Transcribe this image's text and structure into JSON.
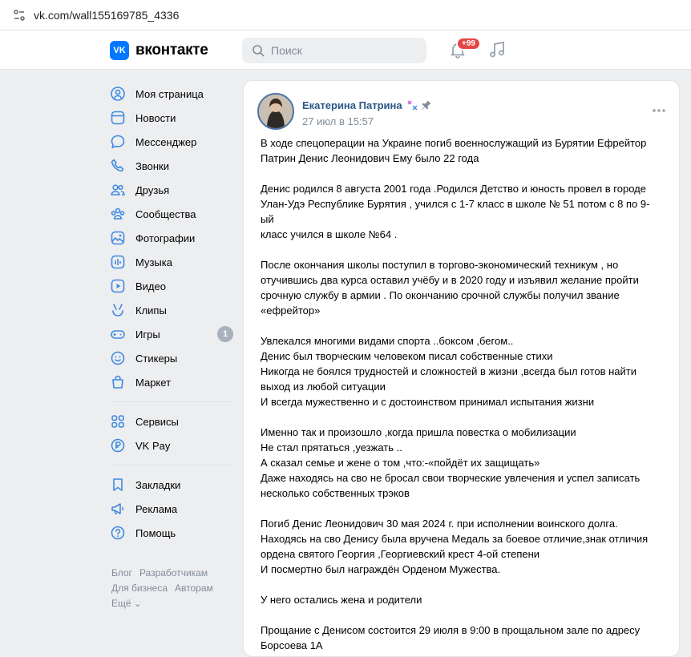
{
  "browser": {
    "url": "vk.com/wall155169785_4336"
  },
  "header": {
    "logo_text": "вконтакте",
    "logo_mark": "VK",
    "search_placeholder": "Поиск",
    "notifications_badge": "+99"
  },
  "menu": {
    "items": [
      {
        "label": "Моя страница",
        "icon": "user-circle-icon"
      },
      {
        "label": "Новости",
        "icon": "news-icon"
      },
      {
        "label": "Мессенджер",
        "icon": "message-icon"
      },
      {
        "label": "Звонки",
        "icon": "phone-icon"
      },
      {
        "label": "Друзья",
        "icon": "friends-icon"
      },
      {
        "label": "Сообщества",
        "icon": "communities-icon"
      },
      {
        "label": "Фотографии",
        "icon": "photos-icon"
      },
      {
        "label": "Музыка",
        "icon": "music-icon"
      },
      {
        "label": "Видео",
        "icon": "video-icon"
      },
      {
        "label": "Клипы",
        "icon": "clips-icon"
      },
      {
        "label": "Игры",
        "icon": "games-icon",
        "count": "1"
      },
      {
        "label": "Стикеры",
        "icon": "stickers-icon"
      },
      {
        "label": "Маркет",
        "icon": "market-icon"
      }
    ],
    "services": [
      {
        "label": "Сервисы",
        "icon": "services-icon"
      },
      {
        "label": "VK Pay",
        "icon": "vkpay-icon"
      }
    ],
    "extra": [
      {
        "label": "Закладки",
        "icon": "bookmark-icon"
      },
      {
        "label": "Реклама",
        "icon": "megaphone-icon"
      },
      {
        "label": "Помощь",
        "icon": "help-icon"
      }
    ],
    "footer": {
      "blog": "Блог",
      "developers": "Разработчикам",
      "business": "Для бизнеса",
      "authors": "Авторам",
      "more": "Ещё"
    }
  },
  "post": {
    "author": "Екатерина Патрина",
    "date": "27 июл в 15:57",
    "text": "В ходе спецоперации на Украине погиб военнослужащий из Бурятии Ефрейтор\nПатрин Денис Леонидович Ему было 22 года\n\nДенис родился 8 августа 2001 года .Родился Детство и юность провел в городе\nУлан-Удэ Республике Бурятия , учился с 1-7 класс в школе № 51 потом с 8 по 9-ый\nкласс учился в школе №64 .\n\nПосле окончания школы поступил в торгово-экономический техникум , но\nотучившись два курса оставил учёбу и в 2020 году и изъявил желание пройти\nсрочную службу в армии . По окончанию срочной службы получил звание\n«ефрейтор»\n\nУвлекался многими видами спорта ..боксом ,бегом..\nДенис был творческим человеком писал собственные стихи\nНикогда не боялся трудностей и сложностей в жизни ,всегда был готов найти\nвыход из любой ситуации\nИ всегда мужественно и с достоинством принимал испытания жизни\n\nИменно так и произошло ,когда пришла повестка о мобилизации\nНе стал прятаться ,уезжать ..\nА сказал семье и жене о том ,что:-«пойдёт их защищать»\nДаже находясь на сво не бросал свои творческие увлечения и успел записать\nнесколько собственных трэков\n\nПогиб Денис Леонидович 30 мая 2024 г. при исполнении воинского долга.\nНаходясь на сво Денису была вручена Медаль за боевое отличие,знак отличия\nордена святого Георгия ,Георгиевский крест 4-ой степени\nИ посмертно был награждён Орденом Мужества.\n\nУ него остались жена и родители\n\nПрощание с Денисом состоится 29 июля в 9:00 в прощальном зале по адресу\nБорсоева 1А"
  },
  "colors": {
    "accent": "#0077ff",
    "link": "#2a5885",
    "muted": "#818c99",
    "badge": "#e64646"
  }
}
